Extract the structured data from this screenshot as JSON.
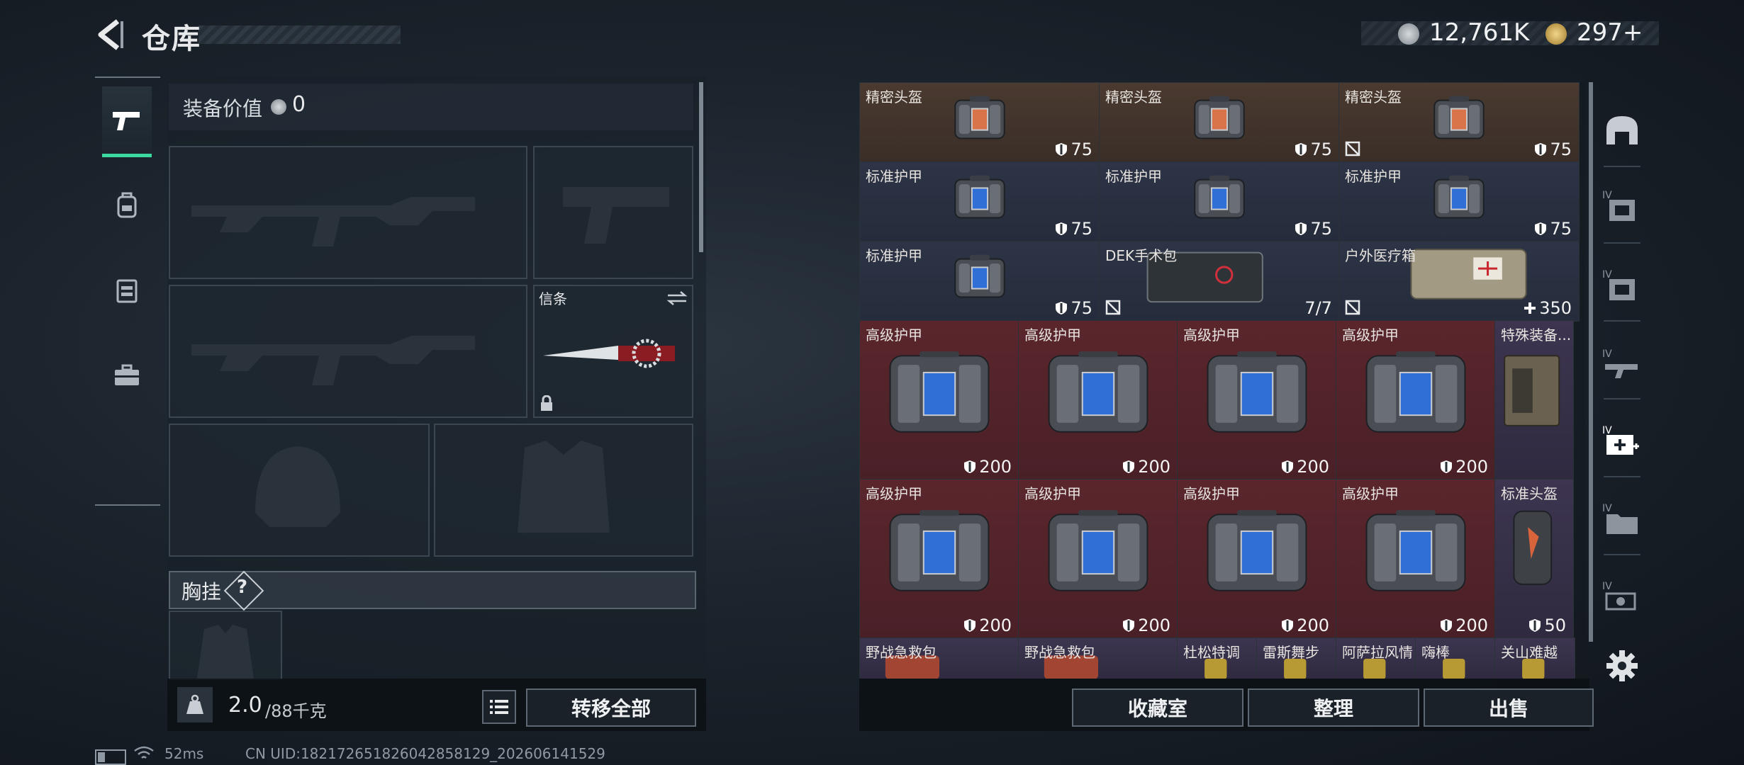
{
  "header": {
    "title": "仓库"
  },
  "currency": {
    "silver": "12,761K",
    "gold": "297+"
  },
  "loadout": {
    "equipment_value_label": "装备价值",
    "equipment_value": "0",
    "secure_label": "信条",
    "chest_rig_label": "胸挂",
    "chest_rig_help": "?"
  },
  "footer_left": {
    "weight": "2.0",
    "weight_cap": "/88千克",
    "transfer_all": "转移全部"
  },
  "stash": {
    "items": [
      {
        "label": "精密头盔",
        "value": "75",
        "bg": "brown",
        "kind": "helmet-bag",
        "no_mark": false
      },
      {
        "label": "精密头盔",
        "value": "75",
        "bg": "brown",
        "kind": "helmet-bag",
        "no_mark": false
      },
      {
        "label": "精密头盔",
        "value": "75",
        "bg": "brown",
        "kind": "helmet-bag",
        "no_mark": true
      },
      {
        "label": "标准护甲",
        "value": "75",
        "bg": "blue",
        "kind": "armor-bag",
        "no_mark": false
      },
      {
        "label": "标准护甲",
        "value": "75",
        "bg": "blue",
        "kind": "armor-bag",
        "no_mark": false
      },
      {
        "label": "标准护甲",
        "value": "75",
        "bg": "blue",
        "kind": "armor-bag",
        "no_mark": false
      },
      {
        "label": "标准护甲",
        "value": "75",
        "bg": "blue",
        "kind": "armor-bag",
        "no_mark": false
      },
      {
        "label": "DEK手术包",
        "value": "7/7",
        "bg": "blue",
        "kind": "surgery-kit",
        "no_mark": true
      },
      {
        "label": "户外医疗箱",
        "value": "350",
        "bg": "blue",
        "kind": "med-box",
        "no_mark": true
      },
      {
        "label": "高级护甲",
        "value": "200",
        "bg": "red",
        "kind": "armor-bag",
        "no_mark": false
      },
      {
        "label": "高级护甲",
        "value": "200",
        "bg": "red",
        "kind": "armor-bag",
        "no_mark": false
      },
      {
        "label": "高级护甲",
        "value": "200",
        "bg": "red",
        "kind": "armor-bag",
        "no_mark": false
      },
      {
        "label": "高级护甲",
        "value": "200",
        "bg": "red",
        "kind": "armor-bag",
        "no_mark": false
      },
      {
        "label": "特殊装备...",
        "value": "",
        "bg": "purple",
        "kind": "special-box",
        "no_mark": false
      },
      {
        "label": "高级护甲",
        "value": "200",
        "bg": "red",
        "kind": "armor-bag",
        "no_mark": false
      },
      {
        "label": "高级护甲",
        "value": "200",
        "bg": "red",
        "kind": "armor-bag",
        "no_mark": false
      },
      {
        "label": "高级护甲",
        "value": "200",
        "bg": "red",
        "kind": "armor-bag",
        "no_mark": false
      },
      {
        "label": "高级护甲",
        "value": "200",
        "bg": "red",
        "kind": "armor-bag",
        "no_mark": false
      },
      {
        "label": "标准头盔",
        "value": "50",
        "bg": "purple",
        "kind": "helmet-small",
        "no_mark": false
      },
      {
        "label": "野战急救包",
        "value": "",
        "bg": "purple",
        "kind": "first-aid",
        "no_mark": false
      },
      {
        "label": "野战急救包",
        "value": "",
        "bg": "purple",
        "kind": "first-aid",
        "no_mark": false
      },
      {
        "label": "杜松特调",
        "value": "",
        "bg": "purple",
        "kind": "drink",
        "no_mark": false
      },
      {
        "label": "雷斯舞步",
        "value": "",
        "bg": "purple",
        "kind": "drink",
        "no_mark": false
      },
      {
        "label": "阿萨拉风情",
        "value": "",
        "bg": "purple",
        "kind": "drink",
        "no_mark": false
      },
      {
        "label": "嗨棒",
        "value": "",
        "bg": "purple",
        "kind": "drink",
        "no_mark": false
      },
      {
        "label": "关山难越",
        "value": "",
        "bg": "purple",
        "kind": "drink",
        "no_mark": false
      }
    ]
  },
  "footer_right": {
    "collection": "收藏室",
    "organize": "整理",
    "sell": "出售"
  },
  "status": {
    "ping": "52ms",
    "uid": "CN UID:18217265182604285812​9_202606141529"
  },
  "colors": {
    "active_tab": "#3bd8a0",
    "advanced_armor_bg": "#5a262c",
    "precision_helmet_bg": "#4a3a30",
    "standard_armor_bg": "#2c3446"
  },
  "icons": {
    "tabs": [
      "pistol-icon",
      "backpack-icon",
      "vest-icon",
      "toolbox-icon"
    ],
    "sidebar": [
      "helmet-icon",
      "body-armor-iv-icon",
      "body-armor-iv-icon",
      "weapon-iv-icon",
      "medkit-iv-icon",
      "folder-iv-icon",
      "gadget-iv-icon",
      "settings-icon"
    ]
  }
}
